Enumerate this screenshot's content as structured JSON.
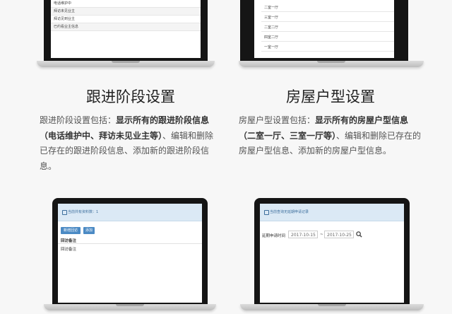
{
  "top_left_screen": {
    "rows": [
      "电话维护中",
      "拜访未见业主",
      "拜访见到业主",
      "已约看业主信息"
    ]
  },
  "top_right_screen": {
    "rows": [
      "二室一厅",
      "三室一厅",
      "二室二厅",
      "四室二厅",
      "一室一厅"
    ]
  },
  "left_section": {
    "title": "跟进阶段设置",
    "desc_prefix": "跟进阶段设置包括：",
    "desc_bold": "显示所有的跟进阶段信息（电话维护中、拜访未见业主等）",
    "desc_suffix": "、编辑和删除已存在的跟进阶段信息、添加新的跟进阶段信息。"
  },
  "right_section": {
    "title": "房屋户型设置",
    "desc_prefix": "房屋户型设置包括：",
    "desc_bold": "显示所有的房屋户型信息（二室一厅、三室一厅等）",
    "desc_suffix": "、编辑和删除已存在的房屋户型信息、添加新的房屋户型信息。"
  },
  "bottom_left_screen": {
    "header": "当前共有资料数：1",
    "btn_primary": "新增回访",
    "btn_secondary": "添加",
    "col_header": "回访备注",
    "row1": "回访备注"
  },
  "bottom_right_screen": {
    "header": "当前查询无延期申请记录",
    "date_label": "延期申请时间",
    "date_from": "2017-10-15",
    "date_sep": "~",
    "date_to": "2017-10-25"
  },
  "icons": [
    "search-icon",
    "info-icon"
  ]
}
